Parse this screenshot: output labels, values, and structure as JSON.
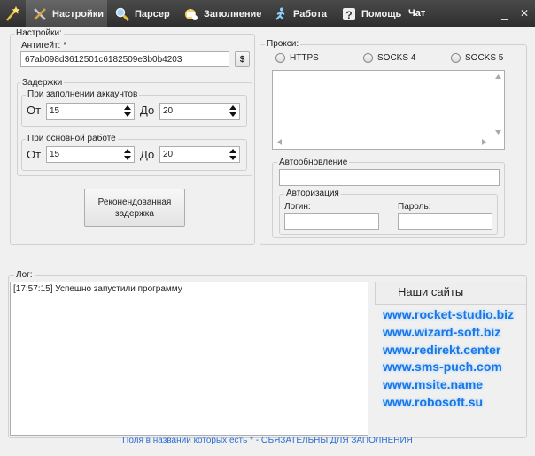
{
  "menu": {
    "items": [
      {
        "label": "Настройки",
        "icon": "tools-icon"
      },
      {
        "label": "Парсер",
        "icon": "magnifier-icon"
      },
      {
        "label": "Заполнение",
        "icon": "fill-icon"
      },
      {
        "label": "Работа",
        "icon": "runner-icon"
      },
      {
        "label": "Помощь",
        "icon": "help-icon"
      }
    ],
    "chat": "Чат",
    "minimize": "_",
    "close": "✕"
  },
  "settings": {
    "title": "Настройки:",
    "antigate_label": "Антигейт: *",
    "antigate_value": "67ab098d3612501c6182509e3b0b4203",
    "balance_button": "$",
    "delays": {
      "title": "Задержки",
      "fill_title": "При заполнении аккаунтов",
      "main_title": "При основной работе",
      "from": "От",
      "to": "До",
      "fill_from": "15",
      "fill_to": "20",
      "main_from": "15",
      "main_to": "20"
    },
    "recommended_button": "Реконендованная задержка"
  },
  "proxy": {
    "title": "Прокси:",
    "options": [
      "HTTPS",
      "SOCKS 4",
      "SOCKS 5"
    ],
    "autoupdate_title": "Автообновление",
    "auth_title": "Авторизация",
    "login_label": "Логин:",
    "password_label": "Пароль:"
  },
  "log": {
    "title": "Лог:",
    "lines": [
      "[17:57:15] Успешно запустили программу"
    ]
  },
  "sites": {
    "title": "Наши сайты",
    "links": [
      "www.rocket-studio.biz",
      "www.wizard-soft.biz",
      "www.redirekt.center",
      "www.sms-puch.com",
      "www.msite.name",
      "www.robosoft.su"
    ]
  },
  "footer": "Поля в названии которых есть * - ОБЯЗАТЕЛЬНЫ ДЛЯ ЗАПОЛНЕНИЯ",
  "colors": {
    "menubar": "#3a3a3a",
    "link": "#1976e8",
    "footer": "#2a6fd6"
  }
}
